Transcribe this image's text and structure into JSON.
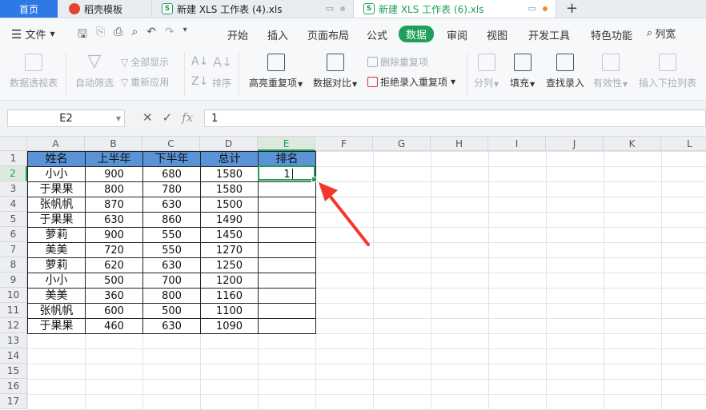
{
  "tabs": {
    "home": "首页",
    "doc1": "稻壳模板",
    "doc2": "新建 XLS 工作表 (4).xls",
    "doc3": "新建 XLS 工作表 (6).xls",
    "xls_icon": "S",
    "new_tab": "+"
  },
  "menu": {
    "file": "文件",
    "tabs": [
      "开始",
      "插入",
      "页面布局",
      "公式",
      "数据",
      "审阅",
      "视图",
      "开发工具",
      "特色功能"
    ],
    "active_tab": "数据",
    "search": "列宽"
  },
  "ribbon": {
    "pivot": "数据透视表",
    "autofilter": "自动筛选",
    "show_all": "全部显示",
    "reapply": "重新应用",
    "sort": "排序",
    "highlight_dup": "高亮重复项",
    "compare": "数据对比",
    "remove_dup": "删除重复项",
    "reject_dup": "拒绝录入重复项",
    "split": "分列",
    "fill": "填充",
    "lookup": "查找录入",
    "validity": "有效性",
    "dropdown": "插入下拉列表"
  },
  "formula_bar": {
    "cell_ref": "E2",
    "value": "1"
  },
  "sheet": {
    "columns": [
      "A",
      "B",
      "C",
      "D",
      "E",
      "F",
      "G",
      "H",
      "I",
      "J",
      "K",
      "L"
    ],
    "rows": [
      "1",
      "2",
      "3",
      "4",
      "5",
      "6",
      "7",
      "8",
      "9",
      "10",
      "11",
      "12",
      "13",
      "14",
      "15",
      "16",
      "17"
    ],
    "selected_col": "E",
    "selected_row": "2",
    "table": [
      [
        "姓名",
        "上半年",
        "下半年",
        "总计",
        "排名"
      ],
      [
        "小小",
        "900",
        "680",
        "1580",
        "1"
      ],
      [
        "于果果",
        "800",
        "780",
        "1580",
        ""
      ],
      [
        "张帆帆",
        "870",
        "630",
        "1500",
        ""
      ],
      [
        "于果果",
        "630",
        "860",
        "1490",
        ""
      ],
      [
        "萝莉",
        "900",
        "550",
        "1450",
        ""
      ],
      [
        "美美",
        "720",
        "550",
        "1270",
        ""
      ],
      [
        "萝莉",
        "620",
        "630",
        "1250",
        ""
      ],
      [
        "小小",
        "500",
        "700",
        "1200",
        ""
      ],
      [
        "美美",
        "360",
        "800",
        "1160",
        ""
      ],
      [
        "张帆帆",
        "600",
        "500",
        "1100",
        ""
      ],
      [
        "于果果",
        "460",
        "630",
        "1090",
        ""
      ]
    ]
  },
  "colors": {
    "accent_green": "#1e9f5a",
    "home_tab_blue": "#2f79e6",
    "header_fill": "#5a93d6",
    "arrow_red": "#f0392b"
  }
}
